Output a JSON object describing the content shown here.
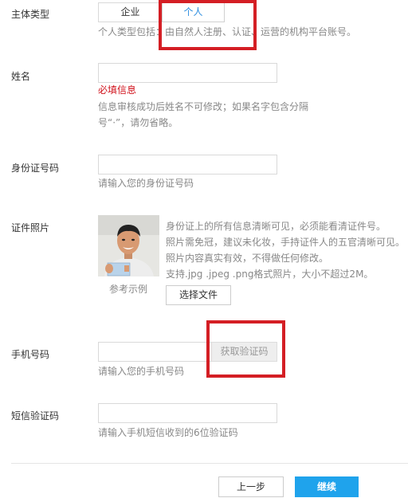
{
  "entity_type": {
    "label": "主体类型",
    "options": [
      "企业",
      "个人"
    ],
    "selected": "个人",
    "hint": "个人类型包括：由自然人注册、认证、运营的机构平台账号。"
  },
  "name": {
    "label": "姓名",
    "required_error": "必填信息",
    "hint_line1": "信息审核成功后姓名不可修改；如果名字包含分隔",
    "hint_line2": "号“·”，请勿省略。"
  },
  "id_number": {
    "label": "身份证号码",
    "hint": "请输入您的身份证号码"
  },
  "id_photo": {
    "label": "证件照片",
    "example_caption": "参考示例",
    "requirements": [
      "身份证上的所有信息清晰可见，必须能看清证件号。",
      "照片需免冠，建议未化妆，手持证件人的五官清晰可见。",
      "照片内容真实有效，不得做任何修改。",
      "支持.jpg .jpeg .png格式照片，大小不超过2M。"
    ],
    "choose_file": "选择文件"
  },
  "phone": {
    "label": "手机号码",
    "get_code": "获取验证码",
    "hint": "请输入您的手机号码"
  },
  "sms_code": {
    "label": "短信验证码",
    "hint": "请输入手机短信收到的6位验证码"
  },
  "footer": {
    "prev": "上一步",
    "next": "继续"
  },
  "colors": {
    "accent_blue": "#2f8fe0",
    "primary_button": "#1fa3ec",
    "error_red": "#d0121b",
    "highlight_box": "#d41e24"
  }
}
